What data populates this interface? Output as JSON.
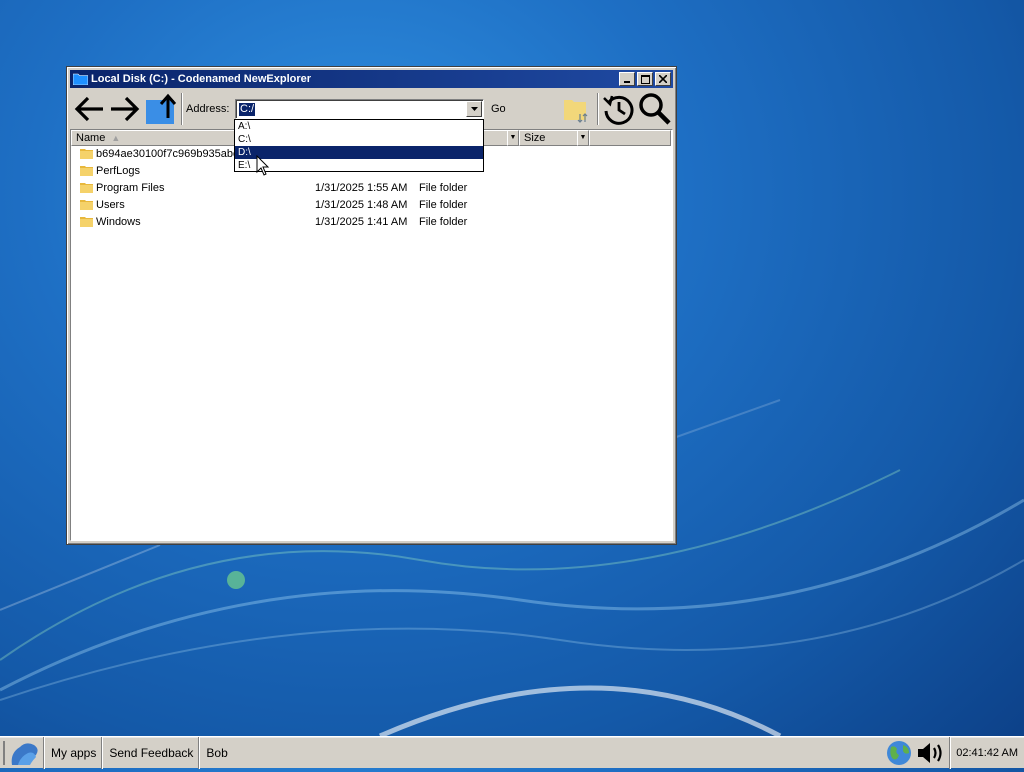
{
  "window": {
    "title": "Local Disk (C:) - Codenamed NewExplorer"
  },
  "toolbar": {
    "address_label": "Address:",
    "address_value": "C:/",
    "go_label": "Go"
  },
  "columns": {
    "name": "Name",
    "size": "Size"
  },
  "files": [
    {
      "name": "b694ae30100f7c969b935abe",
      "date": "",
      "type": ""
    },
    {
      "name": "PerfLogs",
      "date": "",
      "type": ""
    },
    {
      "name": "Program Files",
      "date": "1/31/2025 1:55 AM",
      "type": "File folder"
    },
    {
      "name": "Users",
      "date": "1/31/2025 1:48 AM",
      "type": "File folder"
    },
    {
      "name": "Windows",
      "date": "1/31/2025 1:41 AM",
      "type": "File folder"
    }
  ],
  "address_dropdown": {
    "options": [
      "A:\\",
      "C:\\",
      "D:\\",
      "E:\\"
    ],
    "highlighted": "D:\\"
  },
  "taskbar": {
    "my_apps": "My apps",
    "send_feedback": "Send Feedback",
    "user": "Bob",
    "clock": "02:41:42 AM"
  },
  "icons": {
    "back": "back-arrow-icon",
    "forward": "forward-arrow-icon",
    "up": "up-folder-icon",
    "sync_folder": "folder-sync-icon",
    "history": "history-icon",
    "search": "search-icon",
    "start": "start-logo-icon",
    "network": "globe-icon",
    "volume": "speaker-icon"
  },
  "colors": {
    "titlebar": "#0a246a",
    "selection": "#0a246a",
    "chrome": "#d4d0c8",
    "folder": "#e8b83c"
  }
}
